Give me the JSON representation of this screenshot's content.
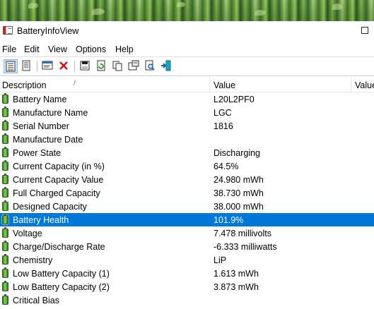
{
  "window": {
    "title": "BatteryInfoView"
  },
  "menu": [
    "File",
    "Edit",
    "View",
    "Options",
    "Help"
  ],
  "toolbar": [
    {
      "icon": "details-view-icon",
      "active": true
    },
    {
      "icon": "list-view-icon",
      "active": false
    },
    {
      "icon": "properties-icon",
      "active": false
    },
    {
      "icon": "delete-icon",
      "active": false
    },
    {
      "icon": "save-icon",
      "active": false
    },
    {
      "icon": "refresh-icon",
      "active": false
    },
    {
      "icon": "copy-icon",
      "active": false
    },
    {
      "icon": "html-report-icon",
      "active": false
    },
    {
      "icon": "find-icon",
      "active": false
    },
    {
      "icon": "exit-icon",
      "active": false
    }
  ],
  "columns": {
    "description": "Description",
    "value": "Value",
    "value2": "Value"
  },
  "rows": [
    {
      "desc": "Battery Name",
      "val": "L20L2PF0"
    },
    {
      "desc": "Manufacture Name",
      "val": "LGC"
    },
    {
      "desc": "Serial Number",
      "val": " 1816"
    },
    {
      "desc": "Manufacture Date",
      "val": ""
    },
    {
      "desc": "Power State",
      "val": "Discharging"
    },
    {
      "desc": "Current Capacity (in %)",
      "val": "64.5%"
    },
    {
      "desc": "Current Capacity Value",
      "val": "24.980 mWh"
    },
    {
      "desc": "Full Charged Capacity",
      "val": "38.730 mWh"
    },
    {
      "desc": "Designed Capacity",
      "val": "38.000 mWh"
    },
    {
      "desc": "Battery Health",
      "val": "101.9%"
    },
    {
      "desc": "Voltage",
      "val": "7.478 millivolts"
    },
    {
      "desc": "Charge/Discharge Rate",
      "val": "-6.333 milliwatts"
    },
    {
      "desc": "Chemistry",
      "val": "LiP"
    },
    {
      "desc": "Low Battery Capacity (1)",
      "val": "1.613 mWh"
    },
    {
      "desc": "Low Battery Capacity (2)",
      "val": "3.873 mWh"
    },
    {
      "desc": "Critical Bias",
      "val": ""
    }
  ],
  "selected_row": "Battery Health",
  "colors": {
    "selection": "#0078d7",
    "battery": "#2e7d1a"
  }
}
